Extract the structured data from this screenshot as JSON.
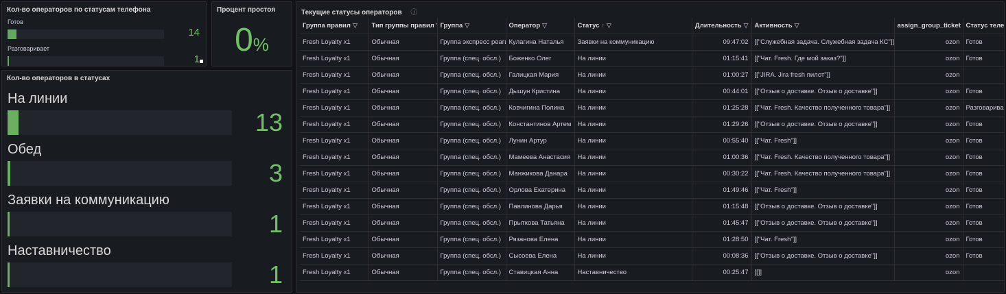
{
  "phone_panel": {
    "title": "Кол-во операторов по статусам телефона",
    "rows": [
      {
        "label": "Готов",
        "value": "14",
        "fraction": 0.057
      },
      {
        "label": "Разговаривает",
        "value": "1",
        "fraction": 0.004
      }
    ]
  },
  "idle_panel": {
    "title": "Процент простоя",
    "value": "0",
    "unit": "%"
  },
  "status_panel": {
    "title": "Кол-во операторов в статусах",
    "rows": [
      {
        "label": "На линии",
        "value": "13",
        "fraction": 0.05
      },
      {
        "label": "Обед",
        "value": "3",
        "fraction": 0.012
      },
      {
        "label": "Заявки на коммуникацию",
        "value": "1",
        "fraction": 0.004
      },
      {
        "label": "Наставничество",
        "value": "1",
        "fraction": 0.004
      }
    ]
  },
  "table_panel": {
    "title": "Текущие статусы операторов",
    "info_icon": "info-icon",
    "columns": [
      "Группа правил",
      "Тип группы правил",
      "Группа",
      "Оператор",
      "Статус",
      "Длительность",
      "Активность",
      "assign_group_ticket",
      "Статус телефона"
    ],
    "rows": [
      [
        "Fresh Loyalty x1",
        "Обычная",
        "Группа экспресс реагирования",
        "Кулагина Наталья",
        "Заявки на коммуникацию",
        "09:47:02",
        "[[\"Служебная задача. Служебная задача КС\"]]",
        "ozon",
        "Готов"
      ],
      [
        "Fresh Loyalty x1",
        "Обычная",
        "Группа (спец. обсл.)",
        "Боженко Олег",
        "На линии",
        "01:15:41",
        "[[\"Чат. Fresh. Где мой заказ?\"]]",
        "ozon",
        "Готов"
      ],
      [
        "Fresh Loyalty x1",
        "Обычная",
        "Группа (спец. обсл.)",
        "Галицкая Мария",
        "На линии",
        "01:00:27",
        "[[\"JIRA. Jira fresh пилот\"]]",
        "ozon",
        ""
      ],
      [
        "Fresh Loyalty x1",
        "Обычная",
        "Группа (спец. обсл.)",
        "Дышун Кристина",
        "На линии",
        "00:44:01",
        "[[\"Отзыв о доставке. Отзыв о доставке\"]]",
        "ozon",
        "Готов"
      ],
      [
        "Fresh Loyalty x1",
        "Обычная",
        "Группа (спец. обсл.)",
        "Ковчигина Полина",
        "На линии",
        "01:25:28",
        "[[\"Чат. Fresh. Качество полученного товара\"]]",
        "ozon",
        "Разговаривает"
      ],
      [
        "Fresh Loyalty x1",
        "Обычная",
        "Группа (спец. обсл.)",
        "Константинов Артем",
        "На линии",
        "01:29:26",
        "[[\"Отзыв о доставке. Отзыв о доставке\"]]",
        "ozon",
        "Готов"
      ],
      [
        "Fresh Loyalty x1",
        "Обычная",
        "Группа (спец. обсл.)",
        "Лунин Артур",
        "На линии",
        "00:55:40",
        "[[\"Чат. Fresh\"]]",
        "ozon",
        "Готов"
      ],
      [
        "Fresh Loyalty x1",
        "Обычная",
        "Группа (спец. обсл.)",
        "Мамеева Анастасия",
        "На линии",
        "01:00:36",
        "[[\"Чат. Fresh. Качество полученного товара\"]]",
        "ozon",
        "Готов"
      ],
      [
        "Fresh Loyalty x1",
        "Обычная",
        "Группа (спец. обсл.)",
        "Манжикова Данара",
        "На линии",
        "00:30:22",
        "[[\"Чат. Fresh. Качество полученного товара\"]]",
        "ozon",
        "Готов"
      ],
      [
        "Fresh Loyalty x1",
        "Обычная",
        "Группа (спец. обсл.)",
        "Орлова Екатерина",
        "На линии",
        "01:49:46",
        "[[\"Чат. Fresh\"]]",
        "ozon",
        "Готов"
      ],
      [
        "Fresh Loyalty x1",
        "Обычная",
        "Группа (спец. обсл.)",
        "Павлинова Дарья",
        "На линии",
        "01:15:48",
        "[[\"Отзыв о доставке. Отзыв о доставке\"]]",
        "ozon",
        "Готов"
      ],
      [
        "Fresh Loyalty x1",
        "Обычная",
        "Группа (спец. обсл.)",
        "Прыткова Татьяна",
        "На линии",
        "01:45:47",
        "[[\"Отзыв о доставке. Отзыв о доставке\"]]",
        "ozon",
        "Готов"
      ],
      [
        "Fresh Loyalty x1",
        "Обычная",
        "Группа (спец. обсл.)",
        "Рязанова Елена",
        "На линии",
        "01:28:50",
        "[[\"Чат. Fresh\"]]",
        "ozon",
        "Готов"
      ],
      [
        "Fresh Loyalty x1",
        "Обычная",
        "Группа (спец. обсл.)",
        "Сысоева Елена",
        "На линии",
        "00:08:36",
        "[[\"Отзыв о доставке. Отзыв о доставке\"]]",
        "ozon",
        "Готов"
      ],
      [
        "Fresh Loyalty x1",
        "Обычная",
        "Группа (спец. обсл.)",
        "Ставицкая Анна",
        "Наставничество",
        "00:25:47",
        "[[]]",
        "ozon",
        ""
      ]
    ]
  },
  "colors": {
    "accent": "#73bf69",
    "background": "#111217",
    "panel": "#181b1f"
  }
}
